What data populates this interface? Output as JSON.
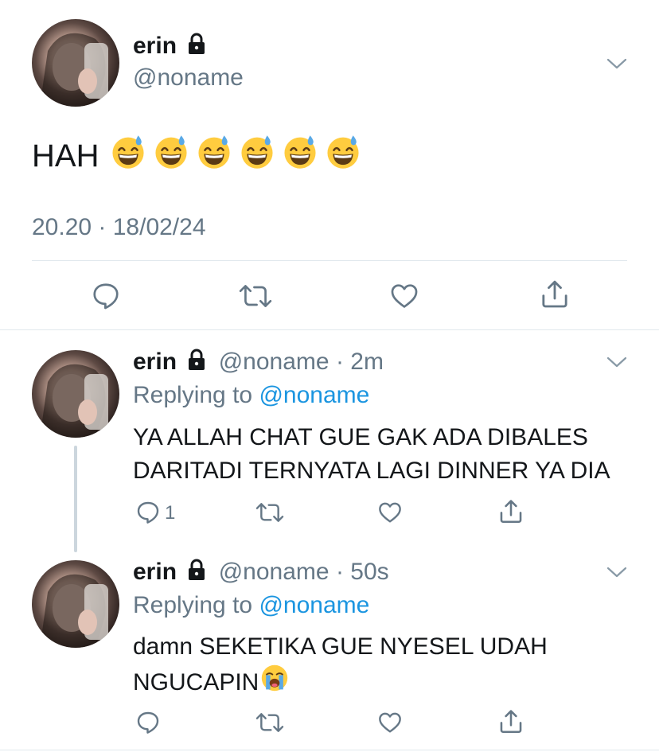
{
  "main_tweet": {
    "display_name": "erin",
    "handle": "@noname",
    "text": "HAH",
    "emoji_count": 6,
    "emoji": "grinning-face-with-sweat",
    "timestamp": "20.20 · 18/02/24",
    "actions": [
      "reply",
      "retweet",
      "like",
      "share"
    ]
  },
  "replies": [
    {
      "display_name": "erin",
      "handle": "@noname",
      "sep": "·",
      "time": "2m",
      "replying_label": "Replying to",
      "replying_to": "@noname",
      "line1": "YA ALLAH CHAT GUE GAK ADA DIBALES",
      "line2": "DARITADI TERNYATA LAGI DINNER YA DIA",
      "reply_count": "1"
    },
    {
      "display_name": "erin",
      "handle": "@noname",
      "sep": "·",
      "time": "50s",
      "replying_label": "Replying to",
      "replying_to": "@noname",
      "line1": "damn SEKETIKA GUE NYESEL UDAH",
      "line2": "NGUCAPIN",
      "trailing_emoji": "loudly-crying-face",
      "reply_count": ""
    }
  ],
  "colors": {
    "text": "#14171a",
    "secondary": "#657786",
    "link": "#1b95e0",
    "divider": "#e1e8ed",
    "emoji_yellow": "#ffcc3f",
    "sweat": "#5aa9e6"
  }
}
